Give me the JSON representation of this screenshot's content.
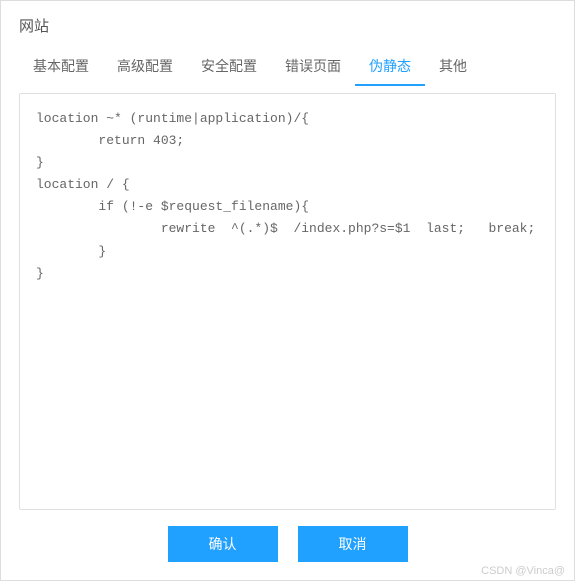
{
  "header": {
    "title": "网站"
  },
  "tabs": [
    {
      "label": "基本配置",
      "active": false
    },
    {
      "label": "高级配置",
      "active": false
    },
    {
      "label": "安全配置",
      "active": false
    },
    {
      "label": "错误页面",
      "active": false
    },
    {
      "label": "伪静态",
      "active": true
    },
    {
      "label": "其他",
      "active": false
    }
  ],
  "config": {
    "content": "location ~* (runtime|application)/{\n        return 403;\n}\nlocation / {\n        if (!-e $request_filename){\n                rewrite  ^(.*)$  /index.php?s=$1  last;   break;\n        }\n}"
  },
  "footer": {
    "confirm_label": "确认",
    "cancel_label": "取消"
  },
  "watermark": "CSDN @Vinca@"
}
